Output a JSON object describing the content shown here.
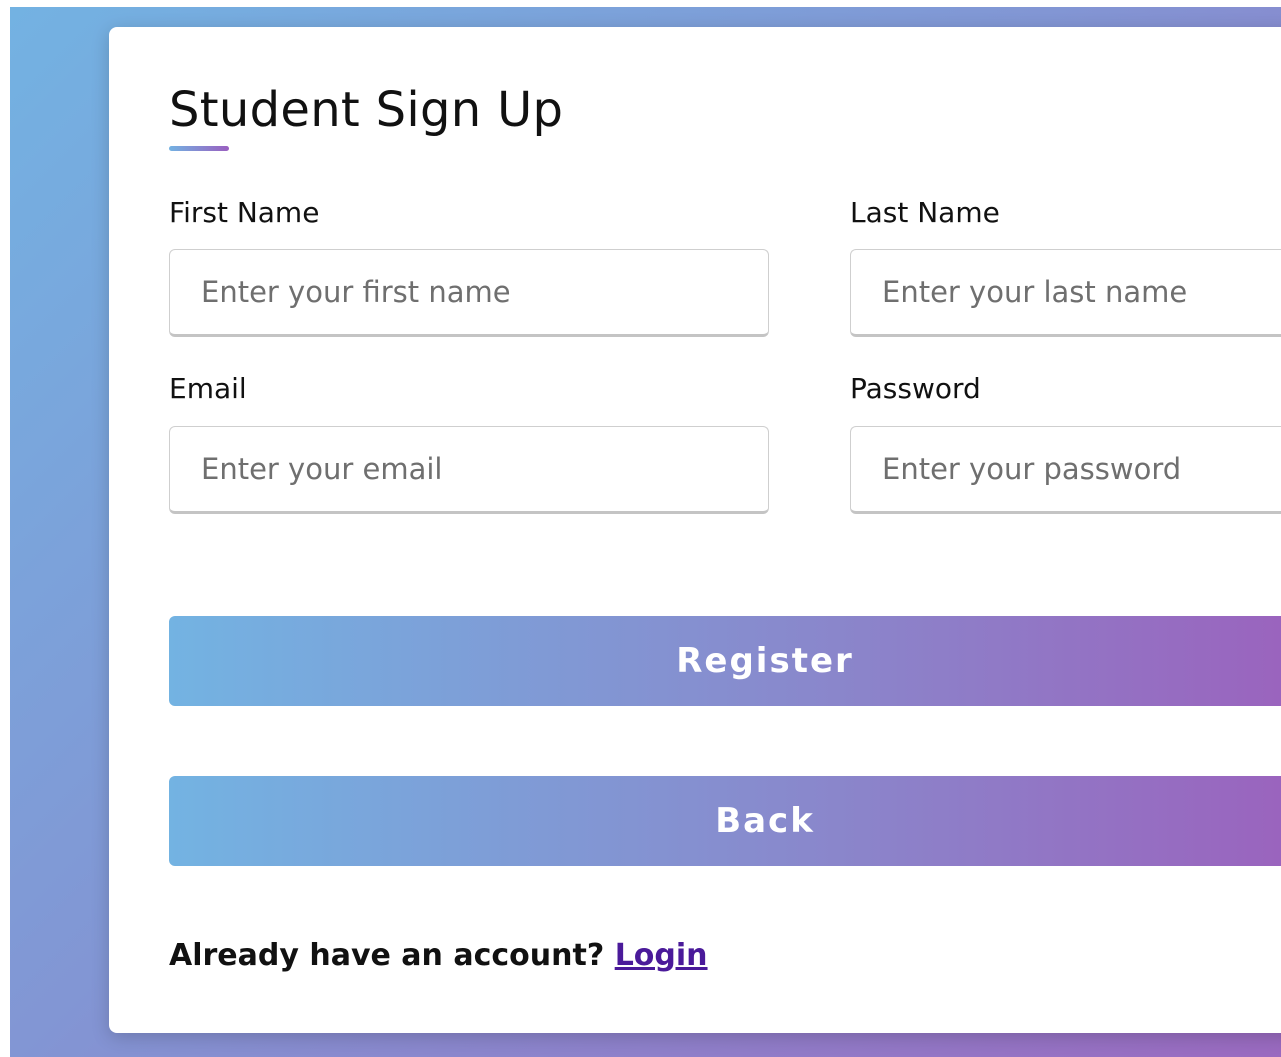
{
  "form": {
    "title": "Student Sign Up",
    "first_name": {
      "label": "First Name",
      "placeholder": "Enter your first name",
      "value": ""
    },
    "last_name": {
      "label": "Last Name",
      "placeholder": "Enter your last name",
      "value": ""
    },
    "email": {
      "label": "Email",
      "placeholder": "Enter your email",
      "value": ""
    },
    "password": {
      "label": "Password",
      "placeholder": "Enter your password",
      "value": ""
    },
    "register_label": "Register",
    "back_label": "Back",
    "login_prompt": "Already have an account?",
    "login_link": "Login"
  },
  "colors": {
    "gradient_start": "#73b2e2",
    "gradient_end": "#9a64be",
    "link": "#4a1a9a"
  }
}
